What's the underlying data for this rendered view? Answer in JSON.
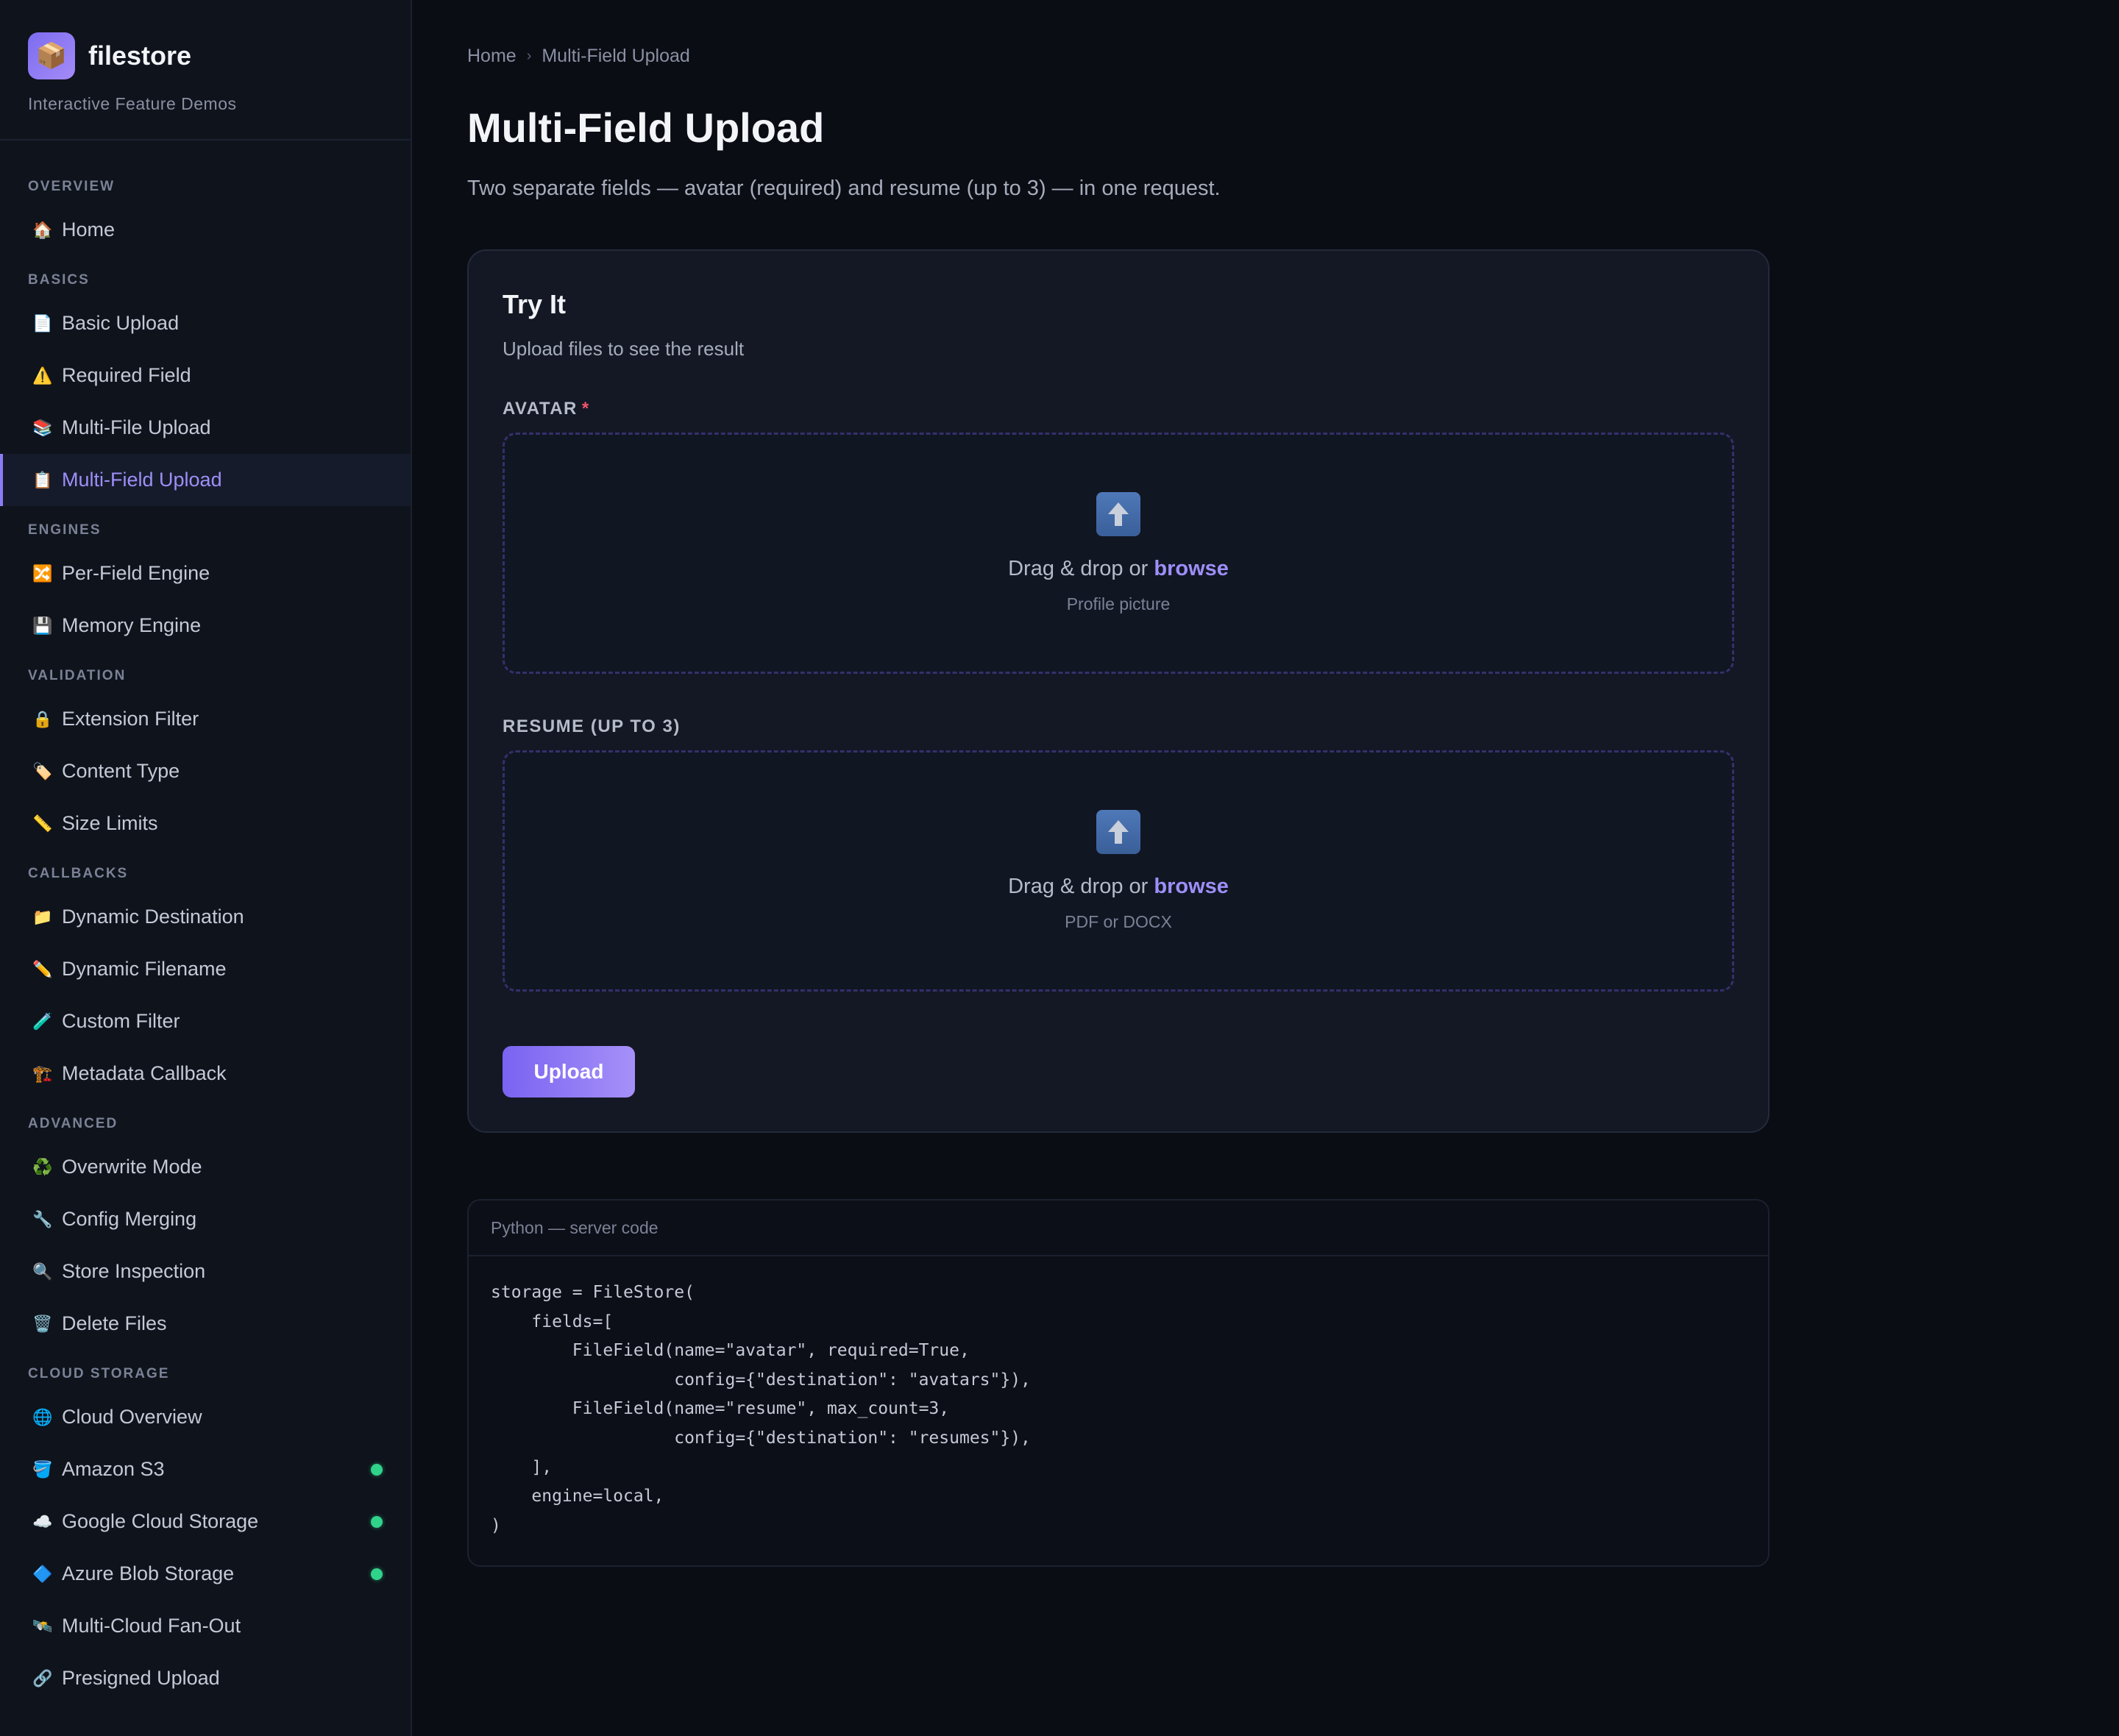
{
  "brand": {
    "logo_icon": "📦",
    "name": "filestore",
    "subtitle": "Interactive Feature Demos"
  },
  "sidebar": {
    "sections": [
      {
        "title": "OVERVIEW",
        "items": [
          {
            "icon": "🏠",
            "label": "Home"
          }
        ]
      },
      {
        "title": "BASICS",
        "items": [
          {
            "icon": "📄",
            "label": "Basic Upload"
          },
          {
            "icon": "⚠️",
            "label": "Required Field"
          },
          {
            "icon": "📚",
            "label": "Multi-File Upload"
          },
          {
            "icon": "📋",
            "label": "Multi-Field Upload",
            "active": true
          }
        ]
      },
      {
        "title": "ENGINES",
        "items": [
          {
            "icon": "🔀",
            "label": "Per-Field Engine"
          },
          {
            "icon": "💾",
            "label": "Memory Engine"
          }
        ]
      },
      {
        "title": "VALIDATION",
        "items": [
          {
            "icon": "🔒",
            "label": "Extension Filter"
          },
          {
            "icon": "🏷️",
            "label": "Content Type"
          },
          {
            "icon": "📏",
            "label": "Size Limits"
          }
        ]
      },
      {
        "title": "CALLBACKS",
        "items": [
          {
            "icon": "📁",
            "label": "Dynamic Destination"
          },
          {
            "icon": "✏️",
            "label": "Dynamic Filename"
          },
          {
            "icon": "🧪",
            "label": "Custom Filter"
          },
          {
            "icon": "🏗️",
            "label": "Metadata Callback"
          }
        ]
      },
      {
        "title": "ADVANCED",
        "items": [
          {
            "icon": "♻️",
            "label": "Overwrite Mode"
          },
          {
            "icon": "🔧",
            "label": "Config Merging"
          },
          {
            "icon": "🔍",
            "label": "Store Inspection"
          },
          {
            "icon": "🗑️",
            "label": "Delete Files"
          }
        ]
      },
      {
        "title": "CLOUD STORAGE",
        "items": [
          {
            "icon": "🌐",
            "label": "Cloud Overview"
          },
          {
            "icon": "🪣",
            "label": "Amazon S3",
            "status": "online"
          },
          {
            "icon": "☁️",
            "label": "Google Cloud Storage",
            "status": "online"
          },
          {
            "icon": "🔷",
            "label": "Azure Blob Storage",
            "status": "online"
          },
          {
            "icon": "🛰️",
            "label": "Multi-Cloud Fan-Out"
          },
          {
            "icon": "🔗",
            "label": "Presigned Upload"
          }
        ]
      }
    ]
  },
  "breadcrumb": {
    "home": "Home",
    "separator": "›",
    "current": "Multi-Field Upload"
  },
  "page": {
    "title": "Multi-Field Upload",
    "description": "Two separate fields — avatar (required) and resume (up to 3) — in one request."
  },
  "try_it": {
    "title": "Try It",
    "subtitle": "Upload files to see the result",
    "avatar": {
      "label": "AVATAR",
      "required_mark": "*",
      "drop_text": "Drag & drop or ",
      "browse": "browse",
      "hint": "Profile picture"
    },
    "resume": {
      "label": "RESUME (UP TO 3)",
      "drop_text": "Drag & drop or ",
      "browse": "browse",
      "hint": "PDF or DOCX"
    },
    "upload_button": "Upload"
  },
  "code": {
    "header": "Python — server code",
    "body": "storage = FileStore(\n    fields=[\n        FileField(name=\"avatar\", required=True,\n                  config={\"destination\": \"avatars\"}),\n        FileField(name=\"resume\", max_count=3,\n                  config={\"destination\": \"resumes\"}),\n    ],\n    engine=local,\n)"
  },
  "colors": {
    "accent": "#8b7cf6",
    "status_online": "#2fd38a",
    "required": "#f0556a"
  }
}
